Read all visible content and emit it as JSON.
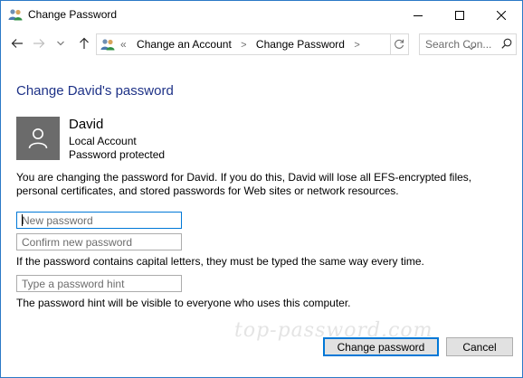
{
  "window": {
    "title": "Change Password"
  },
  "address_bar": {
    "overflow": "«",
    "crumbs": [
      "Change an Account",
      "Change Password"
    ]
  },
  "search": {
    "placeholder": "Search Con..."
  },
  "content": {
    "heading": "Change David's password",
    "user": {
      "name": "David",
      "account_type": "Local Account",
      "status": "Password protected"
    },
    "info": "You are changing the password for David.  If you do this, David will lose all EFS-encrypted files, personal certificates, and stored passwords for Web sites or network resources.",
    "fields": {
      "new_password_placeholder": "New password",
      "confirm_password_placeholder": "Confirm new password",
      "hint_placeholder": "Type a password hint"
    },
    "caps_note": "If the password contains capital letters, they must be typed the same way every time.",
    "hint_note": "The password hint will be visible to everyone who uses this computer.",
    "watermark": "top-password.com"
  },
  "buttons": {
    "change": "Change password",
    "cancel": "Cancel"
  },
  "icons": {
    "title": "users-icon",
    "minimize": "minimize-icon",
    "maximize": "maximize-icon",
    "close": "close-icon",
    "back": "arrow-left-icon",
    "forward": "arrow-right-icon",
    "recent": "chevron-down-icon",
    "up": "arrow-up-icon",
    "refresh": "refresh-icon",
    "search": "search-icon",
    "avatar": "user-icon"
  },
  "colors": {
    "accent": "#0078d7",
    "heading": "#1e3287",
    "avatar_bg": "#6b6b6b",
    "border": "#2b79c6"
  }
}
